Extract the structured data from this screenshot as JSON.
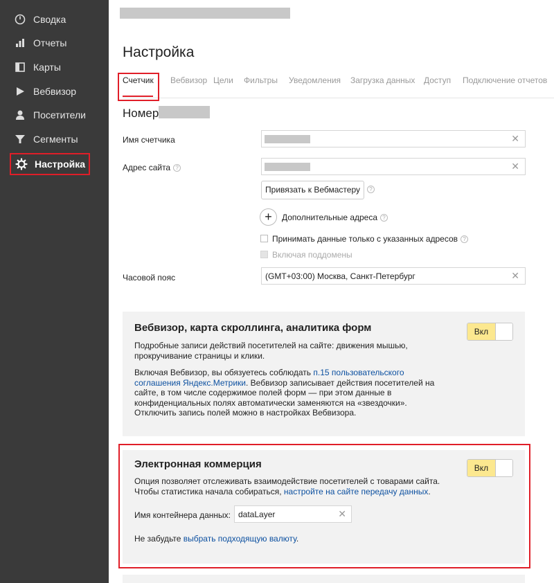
{
  "sidebar": {
    "items": [
      {
        "label": "Сводка",
        "icon": "dashboard-icon"
      },
      {
        "label": "Отчеты",
        "icon": "bar-chart-icon"
      },
      {
        "label": "Карты",
        "icon": "map-icon"
      },
      {
        "label": "Вебвизор",
        "icon": "play-icon"
      },
      {
        "label": "Посетители",
        "icon": "person-icon"
      },
      {
        "label": "Сегменты",
        "icon": "filter-icon"
      },
      {
        "label": "Настройка",
        "icon": "gear-icon",
        "active": true
      }
    ]
  },
  "main": {
    "title": "Настройка",
    "tabs": [
      {
        "label": "Счетчик",
        "active": true
      },
      {
        "label": "Вебвизор"
      },
      {
        "label": "Цели"
      },
      {
        "label": "Фильтры"
      },
      {
        "label": "Уведомления"
      },
      {
        "label": "Загрузка данных"
      },
      {
        "label": "Доступ"
      },
      {
        "label": "Подключение отчетов"
      }
    ],
    "counter_number_label": "Номер",
    "form": {
      "counter_name_label": "Имя счетчика",
      "site_address_label": "Адрес сайта",
      "webmaster_button": "Привязать к Вебмастеру",
      "additional_addresses": "Дополнительные адреса",
      "only_specified_checkbox": "Принимать данные только с указанных адресов",
      "subdomains_checkbox": "Включая поддомены",
      "timezone_label": "Часовой пояс",
      "timezone_value": "(GMT+03:00) Москва, Санкт-Петербург",
      "clear_glyph": "✕"
    },
    "webvisor_panel": {
      "title": "Вебвизор, карта скроллинга, аналитика форм",
      "desc": "Подробные записи действий посетителей на сайте: движения мышью, прокручивание страницы и клики.",
      "text_before_link": "Включая Вебвизор, вы обязуетесь соблюдать ",
      "link": "п.15 пользовательского соглашения Яндекс.Метрики",
      "text_after_link": ". Вебвизор записывает действия посетителей на сайте, в том числе содержимое полей форм — при этом данные в конфиденциальных полях автоматически заменяются на «звездочки». Отключить запись полей можно в настройках Вебвизора.",
      "toggle": "Вкл",
      "enabled": true
    },
    "ecommerce_panel": {
      "title": "Электронная коммерция",
      "desc_line1": "Опция позволяет отслеживать взаимодействие посетителей с товарами сайта.",
      "desc_line2_prefix": "Чтобы статистика начала собираться, ",
      "desc_link": "настройте на сайте передачу данных",
      "desc_line2_suffix": ".",
      "container_label": "Имя контейнера данных:",
      "container_value": "dataLayer",
      "currency_prefix": "Не забудьте ",
      "currency_link": "выбрать подходящую валюту",
      "currency_suffix": ".",
      "toggle": "Вкл",
      "enabled": true
    }
  },
  "colors": {
    "sidebar_bg": "#3a3a3a",
    "highlight_red": "#e01e28",
    "toggle_yellow": "#fce88f",
    "link_blue": "#0c50a0",
    "panel_bg": "#f2f2f2"
  }
}
